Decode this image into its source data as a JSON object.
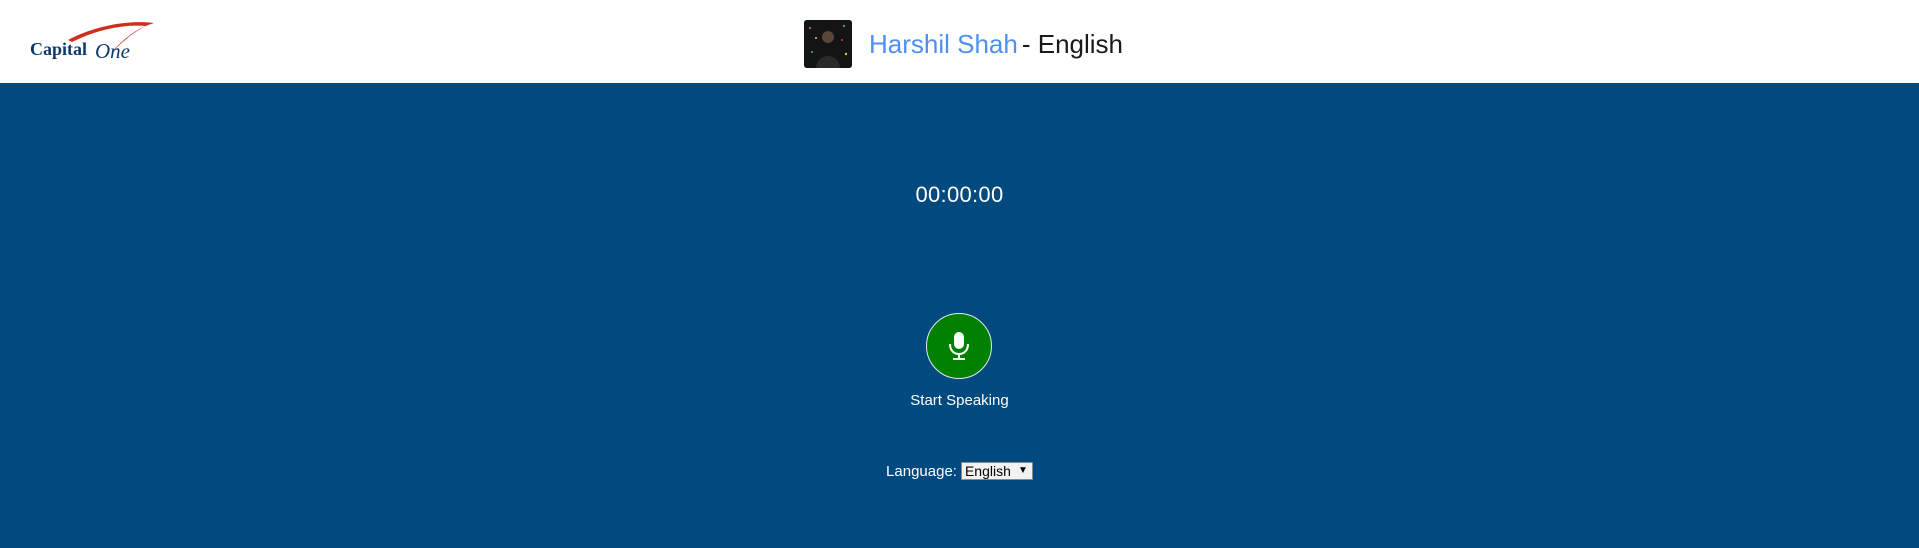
{
  "header": {
    "logo_text": "Capital One",
    "user_name": "Harshil Shah",
    "title_suffix": "- English",
    "avatar_icon": "user-avatar-photo"
  },
  "main": {
    "timer": "00:00:00",
    "mic_icon": "microphone-icon",
    "start_label": "Start Speaking",
    "language_label": "Language:",
    "language_value": "English"
  },
  "colors": {
    "header_bg": "#ffffff",
    "main_bg": "#004a80",
    "mic_button": "#008000",
    "user_name": "#4f8ff0"
  }
}
